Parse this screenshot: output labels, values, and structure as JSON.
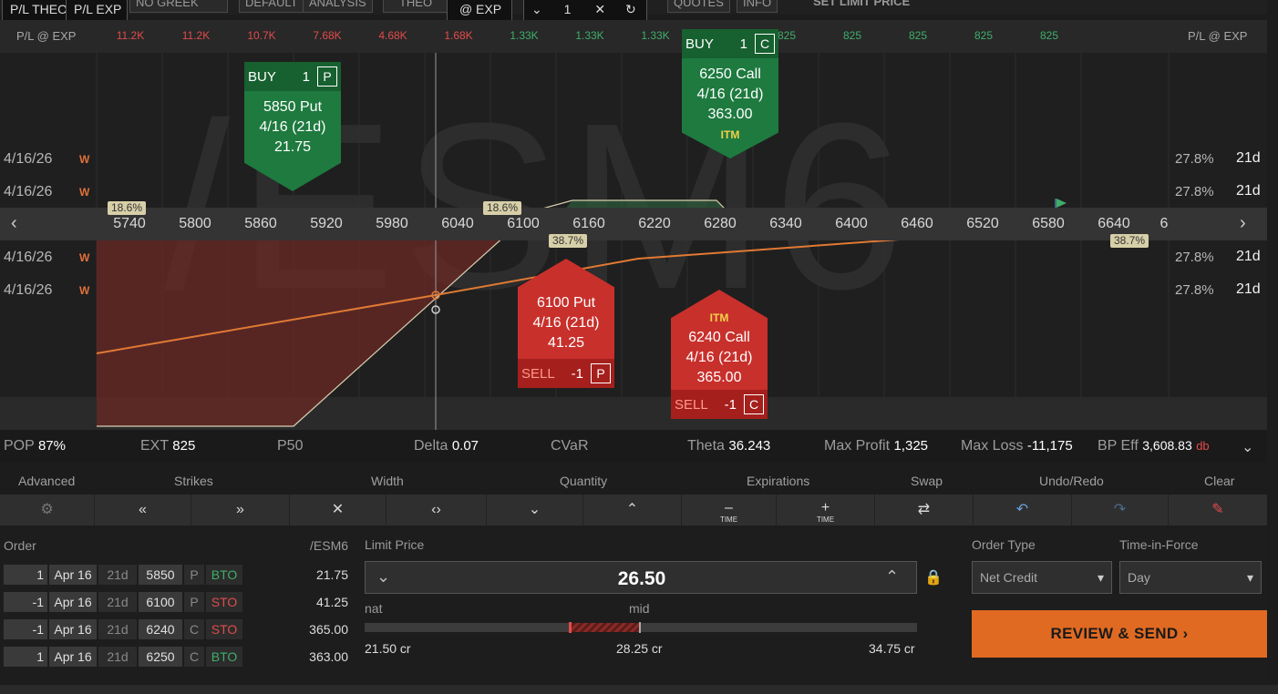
{
  "toolbar": {
    "tabs": [
      "P/L THEO",
      "P/L EXP",
      "NO GREEK",
      "DEFAULT",
      "ANALYSIS",
      "THEO",
      "@ EXP",
      "QUOTES",
      "INFO"
    ],
    "qty": "1",
    "set_limit_price": "SET LIMIT PRICE"
  },
  "plrow": {
    "label_left": "P/L @ EXP",
    "label_right": "P/L @ EXP",
    "values": [
      {
        "text": "11.2K",
        "sign": "neg"
      },
      {
        "text": "11.2K",
        "sign": "neg"
      },
      {
        "text": "10.7K",
        "sign": "neg"
      },
      {
        "text": "7.68K",
        "sign": "neg"
      },
      {
        "text": "4.68K",
        "sign": "neg"
      },
      {
        "text": "1.68K",
        "sign": "neg"
      },
      {
        "text": "1.33K",
        "sign": "pos"
      },
      {
        "text": "1.33K",
        "sign": "pos"
      },
      {
        "text": "1.33K",
        "sign": "pos"
      },
      {
        "text": "825",
        "sign": "pos"
      },
      {
        "text": "825",
        "sign": "pos"
      },
      {
        "text": "825",
        "sign": "pos"
      },
      {
        "text": "825",
        "sign": "pos"
      },
      {
        "text": "825",
        "sign": "pos"
      },
      {
        "text": "825",
        "sign": "pos"
      }
    ]
  },
  "chart": {
    "watermark": "/ESM6",
    "strikes": [
      "5740",
      "5800",
      "5860",
      "5920",
      "5980",
      "6040",
      "6100",
      "6160",
      "6220",
      "6280",
      "6340",
      "6400",
      "6460",
      "6520",
      "6580",
      "6640",
      "6"
    ],
    "rows": [
      {
        "date": "4/16/26",
        "w": "W",
        "iv": "27.8%",
        "dte": "21d"
      },
      {
        "date": "4/16/26",
        "w": "W",
        "iv": "27.8%",
        "dte": "21d"
      },
      {
        "date": "4/16/26",
        "w": "W",
        "iv": "27.8%",
        "dte": "21d"
      },
      {
        "date": "4/16/26",
        "w": "W",
        "iv": "27.8%",
        "dte": "21d"
      }
    ],
    "badges": {
      "left1": "18.6%",
      "left2": "18.6%",
      "right1": "38.7%",
      "right2": "38.7%"
    },
    "legs": {
      "buy_put": {
        "side": "BUY",
        "qty": "1",
        "type": "P",
        "line1": "5850 Put",
        "line2": "4/16 (21d)",
        "line3": "21.75"
      },
      "buy_call": {
        "side": "BUY",
        "qty": "1",
        "type": "C",
        "line1": "6250 Call",
        "line2": "4/16 (21d)",
        "line3": "363.00",
        "tag": "ITM"
      },
      "sell_put": {
        "side": "SELL",
        "qty": "-1",
        "type": "P",
        "line1": "6100 Put",
        "line2": "4/16 (21d)",
        "line3": "41.25"
      },
      "sell_call": {
        "side": "SELL",
        "qty": "-1",
        "type": "C",
        "line1": "6240 Call",
        "line2": "4/16 (21d)",
        "line3": "365.00",
        "tag": "ITM"
      }
    }
  },
  "stats": {
    "pop_label": "POP",
    "pop": "87%",
    "ext_label": "EXT",
    "ext": "825",
    "p50_label": "P50",
    "delta_label": "Delta",
    "delta": "0.07",
    "cvar_label": "CVaR",
    "theta_label": "Theta",
    "theta": "36.243",
    "maxprofit_label": "Max Profit",
    "maxprofit": "1,325",
    "maxloss_label": "Max Loss",
    "maxloss": "-11,175",
    "bpeff_label": "BP Eff",
    "bpeff": "3,608.83",
    "bpeff_unit": "db"
  },
  "controls": {
    "labels": [
      "Advanced",
      "Strikes",
      "Width",
      "Quantity",
      "Expirations",
      "Swap",
      "Undo/Redo",
      "Clear"
    ],
    "time_label": "TIME"
  },
  "order": {
    "order_label": "Order",
    "symbol": "/ESM6",
    "limit_label": "Limit Price",
    "limit_value": "26.50",
    "nat_label": "nat",
    "mid_label": "mid",
    "low": "21.50 cr",
    "mid": "28.25 cr",
    "high": "34.75 cr",
    "order_type_label": "Order Type",
    "order_type": "Net Credit",
    "tif_label": "Time-in-Force",
    "tif": "Day",
    "review_label": "REVIEW & SEND",
    "rows": [
      {
        "qty": "1",
        "exp": "Apr 16",
        "dte": "21d",
        "strike": "5850",
        "type": "P",
        "action": "BTO",
        "price": "21.75"
      },
      {
        "qty": "-1",
        "exp": "Apr 16",
        "dte": "21d",
        "strike": "6100",
        "type": "P",
        "action": "STO",
        "price": "41.25"
      },
      {
        "qty": "-1",
        "exp": "Apr 16",
        "dte": "21d",
        "strike": "6240",
        "type": "C",
        "action": "STO",
        "price": "365.00"
      },
      {
        "qty": "1",
        "exp": "Apr 16",
        "dte": "21d",
        "strike": "6250",
        "type": "C",
        "action": "BTO",
        "price": "363.00"
      }
    ]
  }
}
